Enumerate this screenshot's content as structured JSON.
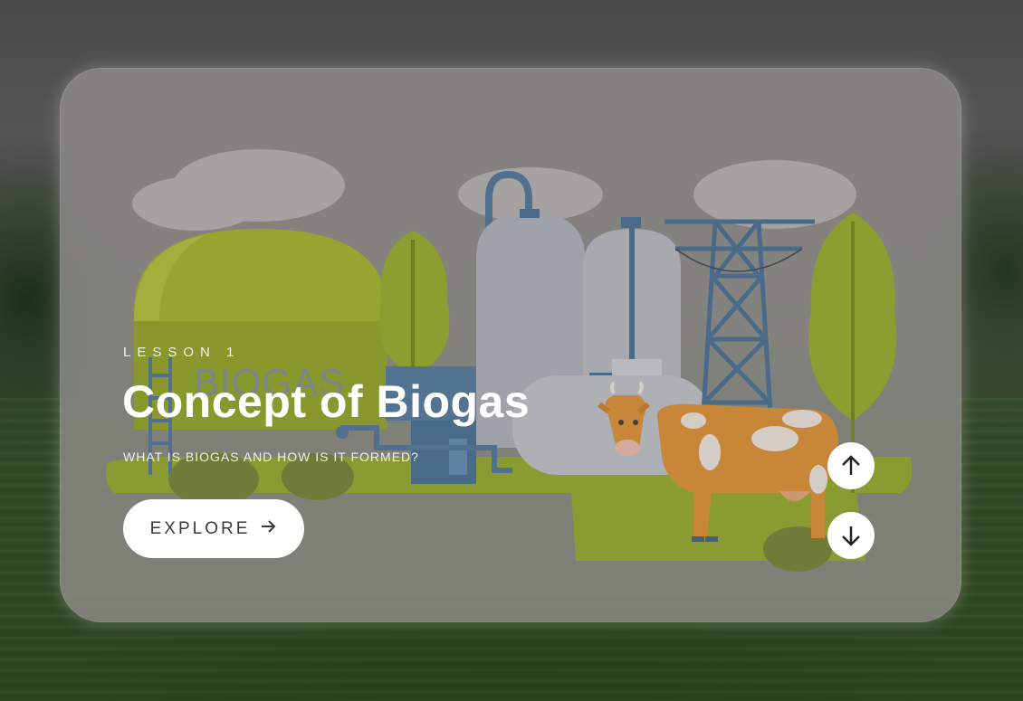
{
  "slide": {
    "eyebrow": "LESSON 1",
    "title": "Concept of Biogas",
    "subtitle": "WHAT IS BIOGAS AND HOW IS IT FORMED?",
    "explore_label": "EXPLORE",
    "illustration_sign": "BIOGAS"
  },
  "icons": {
    "explore_arrow": "arrow-right-icon",
    "prev": "arrow-up-icon",
    "next": "arrow-down-icon"
  },
  "colors": {
    "card": "#969491",
    "accent_green": "#9bb023",
    "tank_gray": "#a9adb5",
    "tower_blue": "#3f6a8e",
    "cow_orange": "#d98a2b",
    "button_bg": "#ffffff"
  }
}
